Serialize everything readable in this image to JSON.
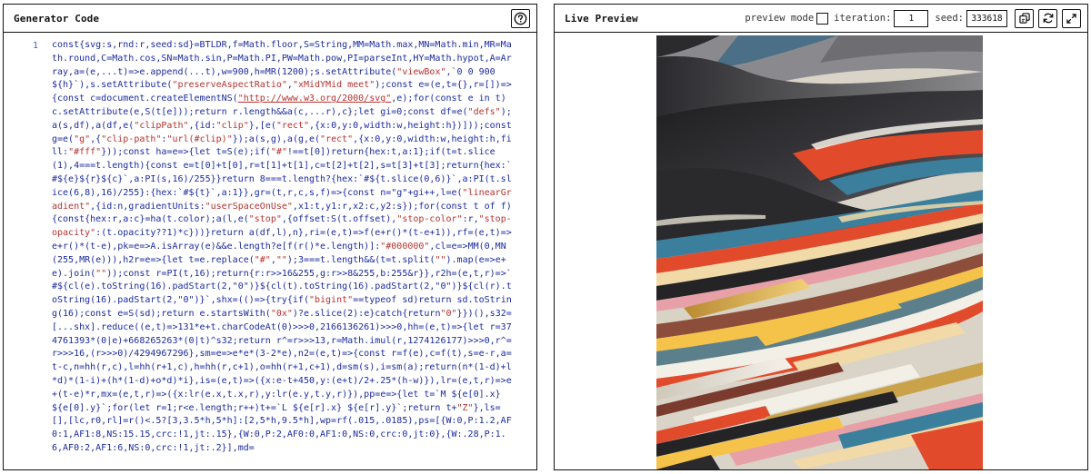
{
  "code_panel": {
    "title": "Generator Code",
    "help_icon": "question-circle-icon",
    "line_numbers": [
      "1"
    ],
    "code": [
      {
        "t": "const{svg:s,rnd:r,seed:sd}=BTLDR,f=Math.floor,S=String,MM=Math.max,MN=Math.min,MR=Math.round,C=Math.cos,SN=Math.sin,P=Math.PI,PW=Math.pow,PI=parseInt,HY=Math.hypot,A=Array,a=(e,...t)=>e.append(...t),w=900,h=MR(1200);s.setAttribute(",
        "k": "c"
      },
      {
        "t": "\"viewBox\"",
        "k": "s"
      },
      {
        "t": ",`0 0 900 ${h}`),s.setAttribute(",
        "k": "c"
      },
      {
        "t": "\"preserveAspectRatio\"",
        "k": "s"
      },
      {
        "t": ",",
        "k": "c"
      },
      {
        "t": "\"xMidYMid meet\"",
        "k": "s"
      },
      {
        "t": ");const e=(e,t={},r=[])=>{const c=document.createElementNS(",
        "k": "c"
      },
      {
        "t": "\"http://www.w3.org/2000/svg\"",
        "k": "u"
      },
      {
        "t": ",e);for(const e in t)c.setAttribute(e,S(t[e]));return r.length&&a(c,...r),c};let gi=0;const df=e(",
        "k": "c"
      },
      {
        "t": "\"defs\"",
        "k": "s"
      },
      {
        "t": ");a(s,df),a(df,e(",
        "k": "c"
      },
      {
        "t": "\"clipPath\"",
        "k": "s"
      },
      {
        "t": ",{id:",
        "k": "c"
      },
      {
        "t": "\"clip\"",
        "k": "s"
      },
      {
        "t": "},[e(",
        "k": "c"
      },
      {
        "t": "\"rect\"",
        "k": "s"
      },
      {
        "t": ",{x:0,y:0,width:w,height:h})]));const g=e(",
        "k": "c"
      },
      {
        "t": "\"g\"",
        "k": "s"
      },
      {
        "t": ",{",
        "k": "c"
      },
      {
        "t": "\"clip-path\"",
        "k": "s"
      },
      {
        "t": ":",
        "k": "c"
      },
      {
        "t": "\"url(#clip)\"",
        "k": "s"
      },
      {
        "t": "});a(s,g),a(g,e(",
        "k": "c"
      },
      {
        "t": "\"rect\"",
        "k": "s"
      },
      {
        "t": ",{x:0,y:0,width:w,height:h,fill:",
        "k": "c"
      },
      {
        "t": "\"#fff\"",
        "k": "s"
      },
      {
        "t": "}));const ha=e=>{let t=S(e);if(",
        "k": "c"
      },
      {
        "t": "\"#\"",
        "k": "s"
      },
      {
        "t": "!==t[0])return{hex:t,a:1};if(t=t.slice(1),4===t.length){const e=t[0]+t[0],r=t[1]+t[1],c=t[2]+t[2],s=t[3]+t[3];return{hex:`#${e}${r}${c}`,a:PI(s,16)/255}}return 8===t.length?{hex:`#${t.slice(0,6)}`,a:PI(t.slice(6,8),16)/255}:{hex:`#${t}`,a:1}},gr=(t,r,c,s,f)=>{const n=\"g\"+gi++,l=e(",
        "k": "c"
      },
      {
        "t": "\"linearGradient\"",
        "k": "s"
      },
      {
        "t": ",{id:n,gradientUnits:",
        "k": "c"
      },
      {
        "t": "\"userSpaceOnUse\"",
        "k": "s"
      },
      {
        "t": ",x1:t,y1:r,x2:c,y2:s});for(const t of f){const{hex:r,a:c}=ha(t.color);a(l,e(",
        "k": "c"
      },
      {
        "t": "\"stop\"",
        "k": "s"
      },
      {
        "t": ",{offset:S(t.offset),",
        "k": "c"
      },
      {
        "t": "\"stop-color\"",
        "k": "s"
      },
      {
        "t": ":r,",
        "k": "c"
      },
      {
        "t": "\"stop-opacity\"",
        "k": "s"
      },
      {
        "t": ":(t.opacity??1)*c}))}return a(df,l),n},ri=(e,t)=>f(e+r()*(t-e+1)),rf=(e,t)=>e+r()*(t-e),pk=e=>A.isArray(e)&&e.length?e[f(r()*e.length)]:",
        "k": "c"
      },
      {
        "t": "\"#000000\"",
        "k": "s"
      },
      {
        "t": ",cl=e=>MM(0,MN(255,MR(e))),h2r=e=>{let t=e.replace(",
        "k": "c"
      },
      {
        "t": "\"#\"",
        "k": "s"
      },
      {
        "t": ",",
        "k": "c"
      },
      {
        "t": "\"\"",
        "k": "s"
      },
      {
        "t": ");3===t.length&&(t=t.split(",
        "k": "c"
      },
      {
        "t": "\"\"",
        "k": "s"
      },
      {
        "t": ").map(e=>e+e).join(",
        "k": "c"
      },
      {
        "t": "\"\"",
        "k": "s"
      },
      {
        "t": "));const r=PI(t,16);return{r:r>>16&255,g:r>>8&255,b:255&r}},r2h=(e,t,r)=>`#${cl(e).toString(16).padStart(2,\"0\")}${cl(t).toString(16).padStart(2,\"0\")}${cl(r).toString(16).padStart(2,\"0\")}`,shx=(()=>{try{if(",
        "k": "c"
      },
      {
        "t": "\"bigint\"",
        "k": "s"
      },
      {
        "t": "==typeof sd)return sd.toString(16);const e=S(sd);return e.startsWith(",
        "k": "c"
      },
      {
        "t": "\"0x\"",
        "k": "s"
      },
      {
        "t": ")?e.slice(2):e}catch{return",
        "k": "c"
      },
      {
        "t": "\"0\"",
        "k": "s"
      },
      {
        "t": "}})(),s32=[...shx].reduce((e,t)=>131*e+t.charCodeAt(0)>>>0,2166136261)>>>0,hh=(e,t)=>{let r=374761393*(0|e)+668265263*(0|t)^s32;return r^=r>>>13,r=Math.imul(r,1274126177)>>>0,r^=r>>>16,(r>>>0)/4294967296},sm=e=>e*e*(3-2*e),n2=(e,t)=>{const r=f(e),c=f(t),s=e-r,a=t-c,n=hh(r,c),l=hh(r+1,c),h=hh(r,c+1),o=hh(r+1,c+1),d=sm(s),i=sm(a);return(n*(1-d)+l*d)*(1-i)+(h*(1-d)+o*d)*i},is=(e,t)=>({x:e-t+450,y:(e+t)/2+.25*(h-w)}),lr=(e,t,r)=>e+(t-e)*r,mx=(e,t,r)=>({x:lr(e.x,t.x,r),y:lr(e.y,t.y,r)}),pp=e=>{let t=`M ${e[0].x} ${e[0].y}`;for(let r=1;r<e.length;r++)t+=`L ${e[r].x} ${e[r].y}`;return t+",
        "k": "c"
      },
      {
        "t": "\"Z\"",
        "k": "s"
      },
      {
        "t": "},ls=[],[lc,r0,rl]=r()<.5?[3,3.5*h,5*h]:[2,5*h,9.5*h],wp=rf(.015,.0185),ps=[{W:0,P:1.2,AF0:1,AF1:8,NS:15.15,crc:!1,jt:.15},{W:0,P:2,AF0:0,AF1:0,NS:0,crc:0,jt:0},{W:.28,P:1.6,AF0:2,AF1:6,NS:0,crc:!1,jt:.2}],md=",
        "k": "c"
      }
    ]
  },
  "preview_panel": {
    "title": "Live Preview",
    "preview_mode_label": "preview mode",
    "preview_mode_checked": false,
    "iteration_label": "iteration:",
    "iteration_value": "1",
    "seed_label": "seed:",
    "seed_value": "333618",
    "icons": {
      "copy": "copy-settings-icon",
      "refresh": "refresh-icon",
      "fullscreen": "expand-icon"
    }
  },
  "colors": {
    "code_text": "#1b2a9e",
    "string_text": "#b4322f",
    "line_number": "#3b67b8",
    "border": "#111111",
    "palette": [
      "#242426",
      "#3b7f9d",
      "#e24a2c",
      "#f1d9a8",
      "#d8d3c4",
      "#f2efe6",
      "#c9a24a",
      "#e8a0a8",
      "#7a3b2e",
      "#5c7f8c",
      "#f6c34a",
      "#8d4d3b"
    ]
  }
}
